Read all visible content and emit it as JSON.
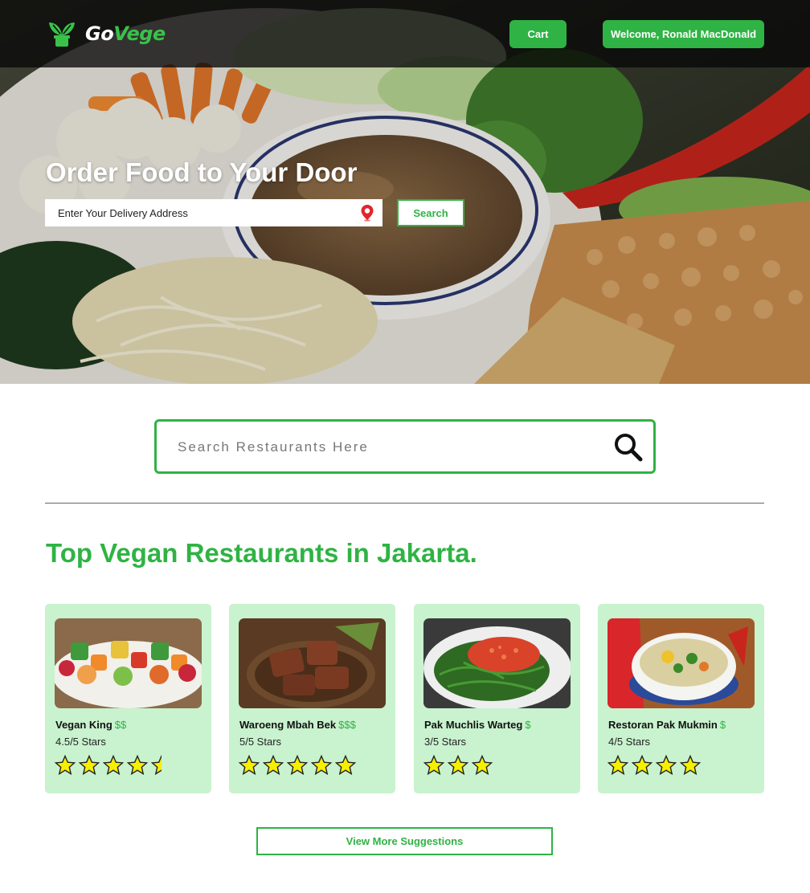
{
  "header": {
    "logo_icon": "sprout-logo-icon",
    "logo_part1": "Go",
    "logo_part2": "Vege",
    "cart_label": "Cart",
    "welcome_label": "Welcome, Ronald MacDonald"
  },
  "hero": {
    "title": "Order Food to Your Door",
    "address_placeholder": "Enter Your Delivery Address",
    "address_icon": "location-pin-icon",
    "search_label": "Search"
  },
  "restaurant_search": {
    "placeholder": "Search Restaurants Here",
    "icon": "magnifier-icon"
  },
  "section": {
    "title": "Top Vegan Restaurants in Jakarta."
  },
  "restaurants": [
    {
      "name": "Vegan King",
      "price": "$$",
      "rating_text": "4.5/5 Stars",
      "rating": 4.5
    },
    {
      "name": "Waroeng Mbah Bek",
      "price": "$$$",
      "rating_text": "5/5 Stars",
      "rating": 5
    },
    {
      "name": "Pak Muchlis Warteg",
      "price": "$",
      "rating_text": "3/5 Stars",
      "rating": 3
    },
    {
      "name": "Restoran Pak Mukmin",
      "price": "$",
      "rating_text": "4/5 Stars",
      "rating": 4
    }
  ],
  "footer": {
    "view_more_label": "View More Suggestions"
  },
  "colors": {
    "brand_green": "#2fb344",
    "card_bg": "#c9f2cf",
    "star_fill": "#f5ef00"
  }
}
